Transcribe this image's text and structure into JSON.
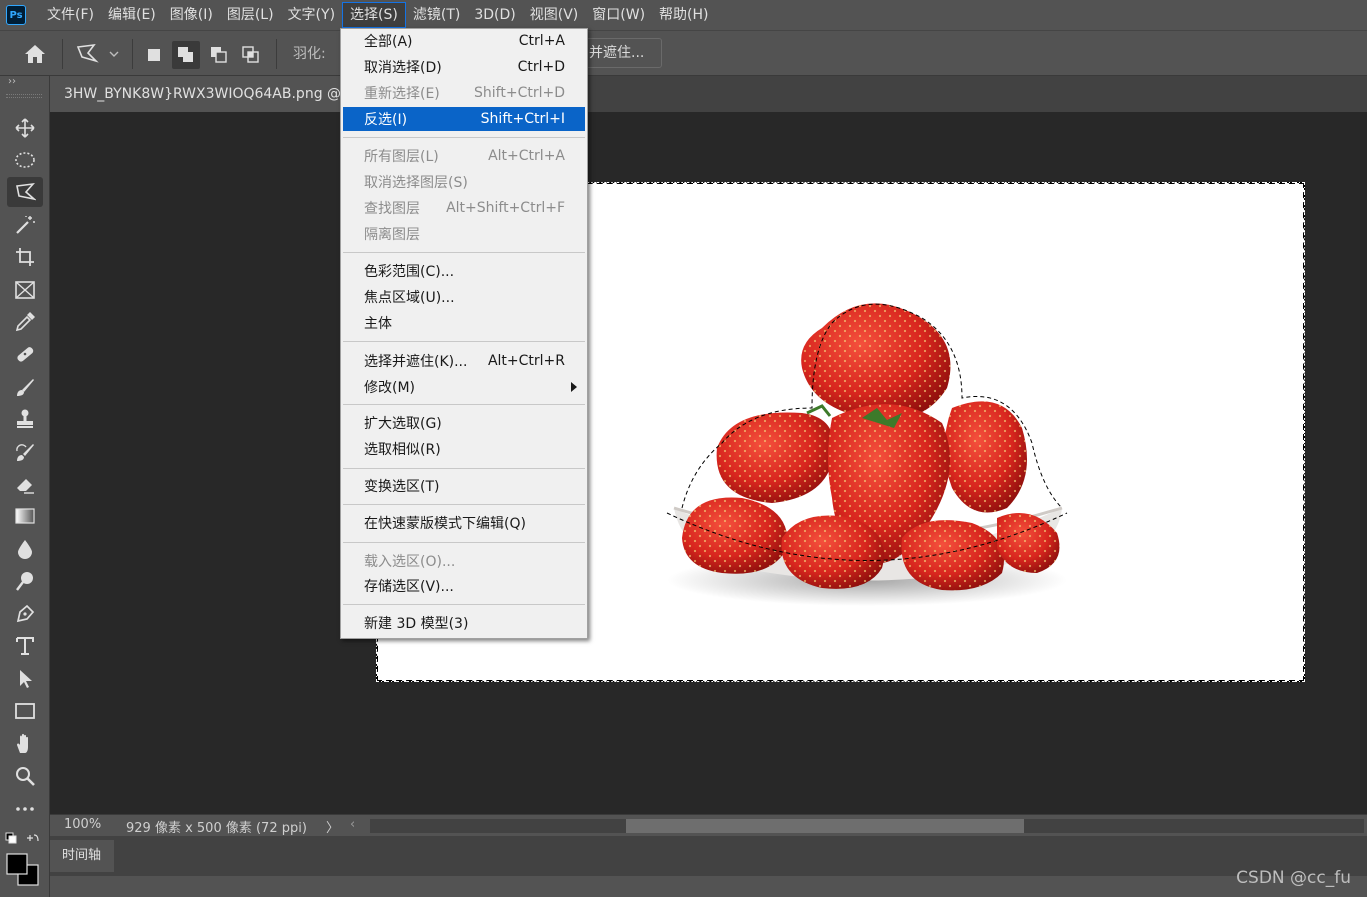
{
  "app": {
    "logo_text": "Ps",
    "menubar": [
      {
        "label": "文件(F)"
      },
      {
        "label": "编辑(E)"
      },
      {
        "label": "图像(I)"
      },
      {
        "label": "图层(L)"
      },
      {
        "label": "文字(Y)"
      },
      {
        "label": "选择(S)",
        "active": true
      },
      {
        "label": "滤镜(T)"
      },
      {
        "label": "3D(D)"
      },
      {
        "label": "视图(V)"
      },
      {
        "label": "窗口(W)"
      },
      {
        "label": "帮助(H)"
      }
    ]
  },
  "options_bar": {
    "feather_label": "羽化:",
    "refine_button_label": "并遮住..."
  },
  "toolbar": {
    "collapse_label": "››",
    "tools": [
      {
        "name": "move-tool",
        "icon": "move-icon"
      },
      {
        "name": "elliptical-marquee-tool",
        "icon": "ellipse-marquee-icon"
      },
      {
        "name": "polygonal-lasso-tool",
        "icon": "polygonal-lasso-icon",
        "selected": true
      },
      {
        "name": "magic-wand-tool",
        "icon": "magic-wand-icon"
      },
      {
        "name": "crop-tool",
        "icon": "crop-icon"
      },
      {
        "name": "frame-tool",
        "icon": "frame-icon"
      },
      {
        "name": "eyedropper-tool",
        "icon": "eyedropper-icon"
      },
      {
        "name": "healing-brush-tool",
        "icon": "bandage-icon"
      },
      {
        "name": "brush-tool",
        "icon": "brush-icon"
      },
      {
        "name": "clone-stamp-tool",
        "icon": "stamp-icon"
      },
      {
        "name": "history-brush-tool",
        "icon": "history-brush-icon"
      },
      {
        "name": "eraser-tool",
        "icon": "eraser-icon"
      },
      {
        "name": "gradient-tool",
        "icon": "gradient-icon"
      },
      {
        "name": "blur-tool",
        "icon": "drop-icon"
      },
      {
        "name": "dodge-tool",
        "icon": "dodge-icon"
      },
      {
        "name": "pen-tool",
        "icon": "pen-icon"
      },
      {
        "name": "type-tool",
        "icon": "type-icon"
      },
      {
        "name": "path-selection-tool",
        "icon": "arrow-icon"
      },
      {
        "name": "rectangle-tool",
        "icon": "rectangle-icon"
      },
      {
        "name": "hand-tool",
        "icon": "hand-icon"
      },
      {
        "name": "zoom-tool",
        "icon": "zoom-icon"
      },
      {
        "name": "more-tools",
        "icon": "ellipsis-icon"
      }
    ]
  },
  "document": {
    "tab_title": "3HW_BYNK8W}RWX3WIOQ64AB.png @ 1"
  },
  "status_bar": {
    "zoom": "100%",
    "doc_info": "929 像素 x 500 像素 (72 ppi)",
    "arrow": "〉",
    "scroll_left": "‹"
  },
  "timeline": {
    "tab_label": "时间轴"
  },
  "watermark": "CSDN @cc_fu",
  "select_menu": {
    "items": [
      {
        "label": "全部(A)",
        "shortcut": "Ctrl+A",
        "disabled": false
      },
      {
        "label": "取消选择(D)",
        "shortcut": "Ctrl+D",
        "disabled": false
      },
      {
        "label": "重新选择(E)",
        "shortcut": "Shift+Ctrl+D",
        "disabled": true
      },
      {
        "label": "反选(I)",
        "shortcut": "Shift+Ctrl+I",
        "disabled": false,
        "highlighted": true
      },
      {
        "label": "所有图层(L)",
        "shortcut": "Alt+Ctrl+A",
        "disabled": true
      },
      {
        "label": "取消选择图层(S)",
        "shortcut": "",
        "disabled": true
      },
      {
        "label": "查找图层",
        "shortcut": "Alt+Shift+Ctrl+F",
        "disabled": true
      },
      {
        "label": "隔离图层",
        "shortcut": "",
        "disabled": true
      },
      {
        "label": "色彩范围(C)...",
        "shortcut": "",
        "disabled": false
      },
      {
        "label": "焦点区域(U)...",
        "shortcut": "",
        "disabled": false
      },
      {
        "label": "主体",
        "shortcut": "",
        "disabled": false
      },
      {
        "label": "选择并遮住(K)...",
        "shortcut": "Alt+Ctrl+R",
        "disabled": false
      },
      {
        "label": "修改(M)",
        "shortcut": "",
        "disabled": false,
        "submenu": true
      },
      {
        "label": "扩大选取(G)",
        "shortcut": "",
        "disabled": false
      },
      {
        "label": "选取相似(R)",
        "shortcut": "",
        "disabled": false
      },
      {
        "label": "变换选区(T)",
        "shortcut": "",
        "disabled": false
      },
      {
        "label": "在快速蒙版模式下编辑(Q)",
        "shortcut": "",
        "disabled": false
      },
      {
        "label": "载入选区(O)...",
        "shortcut": "",
        "disabled": true
      },
      {
        "label": "存储选区(V)...",
        "shortcut": "",
        "disabled": false
      },
      {
        "label": "新建 3D 模型(3)",
        "shortcut": "",
        "disabled": false
      }
    ]
  },
  "colors": {
    "accent": "#1473e6",
    "menu_highlight": "#0a64c8",
    "strawberry_red": "#d8261e"
  }
}
